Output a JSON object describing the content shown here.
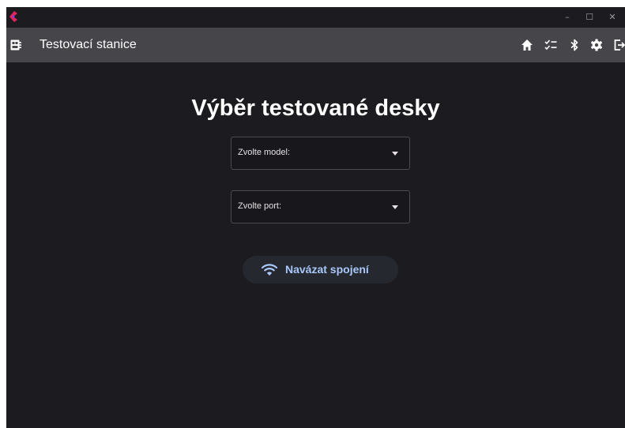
{
  "window": {
    "minimize_symbol": "–",
    "maximize_symbol": "☐",
    "close_symbol": "✕"
  },
  "appbar": {
    "title": "Testovací stanice",
    "icons": [
      "developer-board-icon",
      "home-icon",
      "checklist-icon",
      "bluetooth-icon",
      "settings-icon",
      "logout-icon"
    ]
  },
  "main": {
    "heading": "Výběr testované desky",
    "model_select": {
      "label": "Zvolte model:"
    },
    "port_select": {
      "label": "Zvolte port:"
    },
    "connect_button": {
      "label": "Navázat spojení",
      "icon": "wifi-icon"
    }
  },
  "colors": {
    "background": "#1c1b1f",
    "appbar": "#45454a",
    "accent_text": "#a8c7fa",
    "logo": "#e0245e"
  }
}
